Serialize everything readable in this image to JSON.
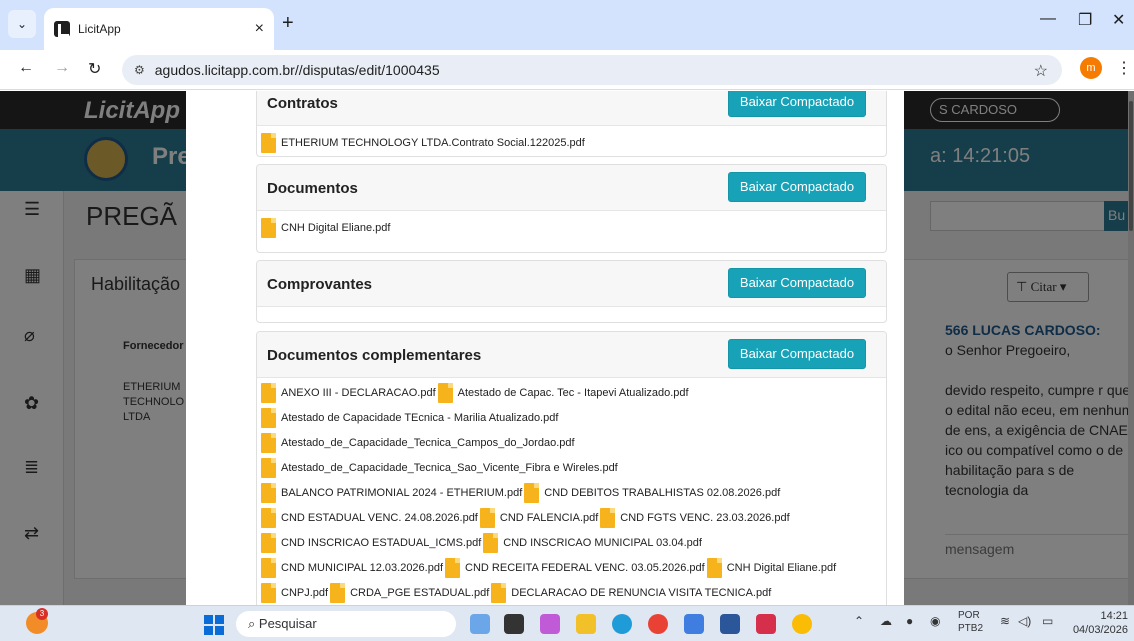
{
  "browser": {
    "tab_title": "LicitApp",
    "tab_close": "×",
    "new_tab": "+",
    "url": "agudos.licitapp.com.br//disputas/edit/1000435",
    "profile_initial": "m",
    "window_minimize": "—",
    "window_restore": "❐",
    "window_close": "✕"
  },
  "background_page": {
    "logo": "LicitApp",
    "band_title": "Pre",
    "user_label": "S CARDOSO",
    "band_time": "a: 14:21:05",
    "page_heading": "PREGÃ",
    "search_button": "Bu",
    "panel_title": "Habilitação",
    "supplier_header": "Fornecedor",
    "supplier_name": "ETHERIUM TECHNOLO LTDA",
    "citar_label": "Citar",
    "chat_author": "566 LUCAS CARDOSO:",
    "chat_text": "o Senhor Pregoeiro,\n\ndevido respeito, cumpre r que o edital não eceu, em nenhum de ens, a exigência de CNAE ico ou compatível como o de habilitação para s de tecnologia da",
    "message_placeholder": "mensagem"
  },
  "modal": {
    "sections": [
      {
        "title": "Contratos",
        "button": "Baixar Compactado",
        "files": [
          "ETHERIUM TECHNOLOGY LTDA.Contrato Social.122025.pdf"
        ]
      },
      {
        "title": "Documentos",
        "button": "Baixar Compactado",
        "files": [
          "CNH Digital Eliane.pdf"
        ]
      },
      {
        "title": "Comprovantes",
        "button": "Baixar Compactado",
        "files": []
      },
      {
        "title": "Documentos complementares",
        "button": "Baixar Compactado",
        "file_rows": [
          [
            "ANEXO III - DECLARACAO.pdf",
            "Atestado de Capac. Tec - Itapevi Atualizado.pdf"
          ],
          [
            "Atestado de Capacidade TEcnica - Marilia Atualizado.pdf"
          ],
          [
            "Atestado_de_Capacidade_Tecnica_Campos_do_Jordao.pdf"
          ],
          [
            "Atestado_de_Capacidade_Tecnica_Sao_Vicente_Fibra e Wireles.pdf"
          ],
          [
            "BALANCO PATRIMONIAL 2024 - ETHERIUM.pdf",
            "CND DEBITOS TRABALHISTAS 02.08.2026.pdf"
          ],
          [
            "CND ESTADUAL VENC. 24.08.2026.pdf",
            "CND FALENCIA.pdf",
            "CND FGTS VENC. 23.03.2026.pdf"
          ],
          [
            "CND INSCRICAO ESTADUAL_ICMS.pdf",
            "CND INSCRICAO MUNICIPAL 03.04.pdf"
          ],
          [
            "CND MUNICIPAL 12.03.2026.pdf",
            "CND RECEITA FEDERAL VENC. 03.05.2026.pdf",
            "CNH Digital Eliane.pdf"
          ],
          [
            "CNPJ.pdf",
            "CRDA_PGE ESTADUAL.pdf",
            "DECLARACAO DE RENUNCIA VISITA TECNICA.pdf"
          ]
        ]
      }
    ]
  },
  "taskbar": {
    "weather_badge": "3",
    "search_placeholder": "Pesquisar",
    "lang_1": "POR",
    "lang_2": "PTB2",
    "time": "14:21",
    "date": "04/03/2026"
  },
  "colors": {
    "accent_button": "#17a2b8",
    "file_icon": "#f7b31b",
    "app_band": "#2c7a94"
  }
}
